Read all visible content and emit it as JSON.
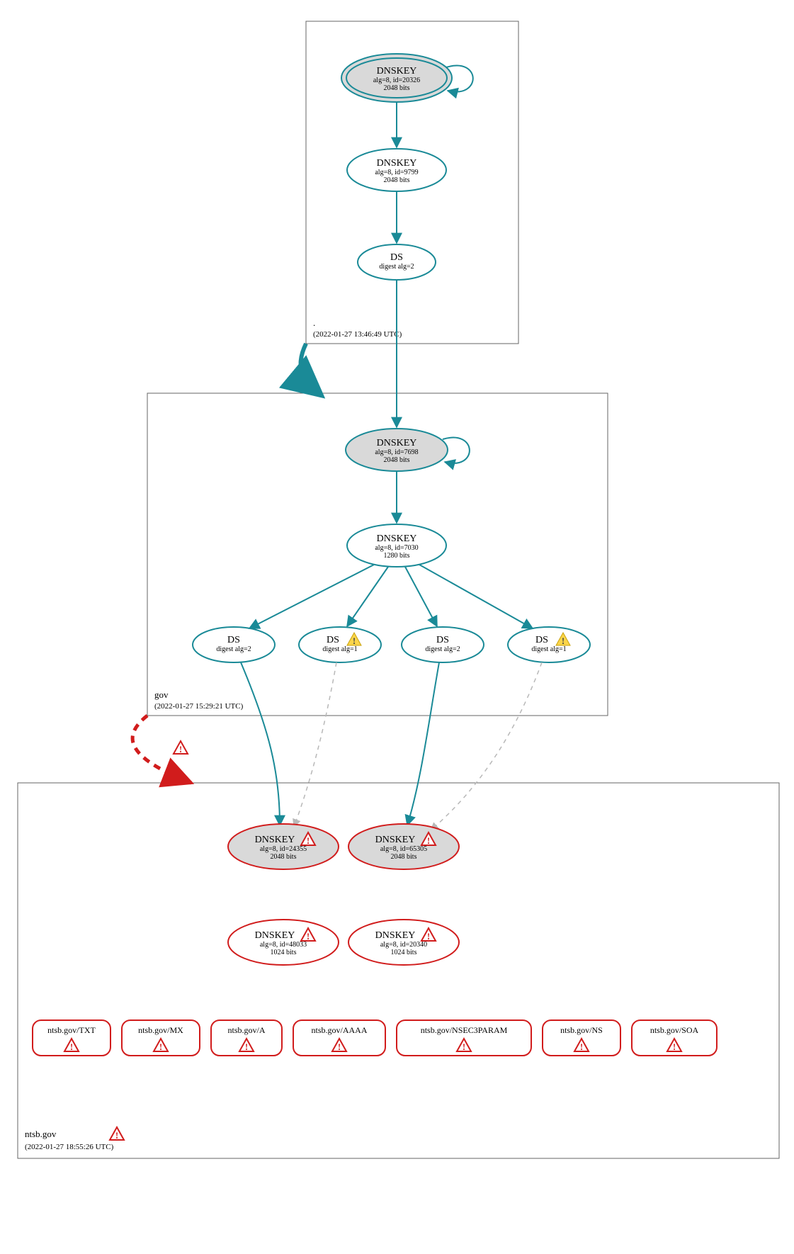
{
  "colors": {
    "teal": "#1a8a97",
    "red": "#d11c1c",
    "greyFill": "#d9d9d9",
    "zoneBorder": "#666666",
    "dashGrey": "#b8b8b8"
  },
  "zones": {
    "root": {
      "name": ".",
      "timestamp": "(2022-01-27 13:46:49 UTC)",
      "error": false
    },
    "gov": {
      "name": "gov",
      "timestamp": "(2022-01-27 15:29:21 UTC)",
      "error": false
    },
    "ntsb": {
      "name": "ntsb.gov",
      "timestamp": "(2022-01-27 18:55:26 UTC)",
      "error": true
    }
  },
  "nodes": {
    "root_ksk": {
      "title": "DNSKEY",
      "line2": "alg=8, id=20326",
      "line3": "2048 bits"
    },
    "root_zsk": {
      "title": "DNSKEY",
      "line2": "alg=8, id=9799",
      "line3": "2048 bits"
    },
    "root_ds": {
      "title": "DS",
      "line2": "digest alg=2"
    },
    "gov_ksk": {
      "title": "DNSKEY",
      "line2": "alg=8, id=7698",
      "line3": "2048 bits"
    },
    "gov_zsk": {
      "title": "DNSKEY",
      "line2": "alg=8, id=7030",
      "line3": "1280 bits"
    },
    "gov_ds1": {
      "title": "DS",
      "line2": "digest alg=2",
      "warn": false
    },
    "gov_ds2": {
      "title": "DS",
      "line2": "digest alg=1",
      "warn": true
    },
    "gov_ds3": {
      "title": "DS",
      "line2": "digest alg=2",
      "warn": false
    },
    "gov_ds4": {
      "title": "DS",
      "line2": "digest alg=1",
      "warn": true
    },
    "ntsb_k1": {
      "title": "DNSKEY",
      "line2": "alg=8, id=24355",
      "line3": "2048 bits",
      "err": true
    },
    "ntsb_k2": {
      "title": "DNSKEY",
      "line2": "alg=8, id=65305",
      "line3": "2048 bits",
      "err": true
    },
    "ntsb_k3": {
      "title": "DNSKEY",
      "line2": "alg=8, id=48033",
      "line3": "1024 bits",
      "err": true
    },
    "ntsb_k4": {
      "title": "DNSKEY",
      "line2": "alg=8, id=20340",
      "line3": "1024 bits",
      "err": true
    },
    "rr_txt": {
      "label": "ntsb.gov/TXT"
    },
    "rr_mx": {
      "label": "ntsb.gov/MX"
    },
    "rr_a": {
      "label": "ntsb.gov/A"
    },
    "rr_aaaa": {
      "label": "ntsb.gov/AAAA"
    },
    "rr_nsec3": {
      "label": "ntsb.gov/NSEC3PARAM"
    },
    "rr_ns": {
      "label": "ntsb.gov/NS"
    },
    "rr_soa": {
      "label": "ntsb.gov/SOA"
    }
  }
}
